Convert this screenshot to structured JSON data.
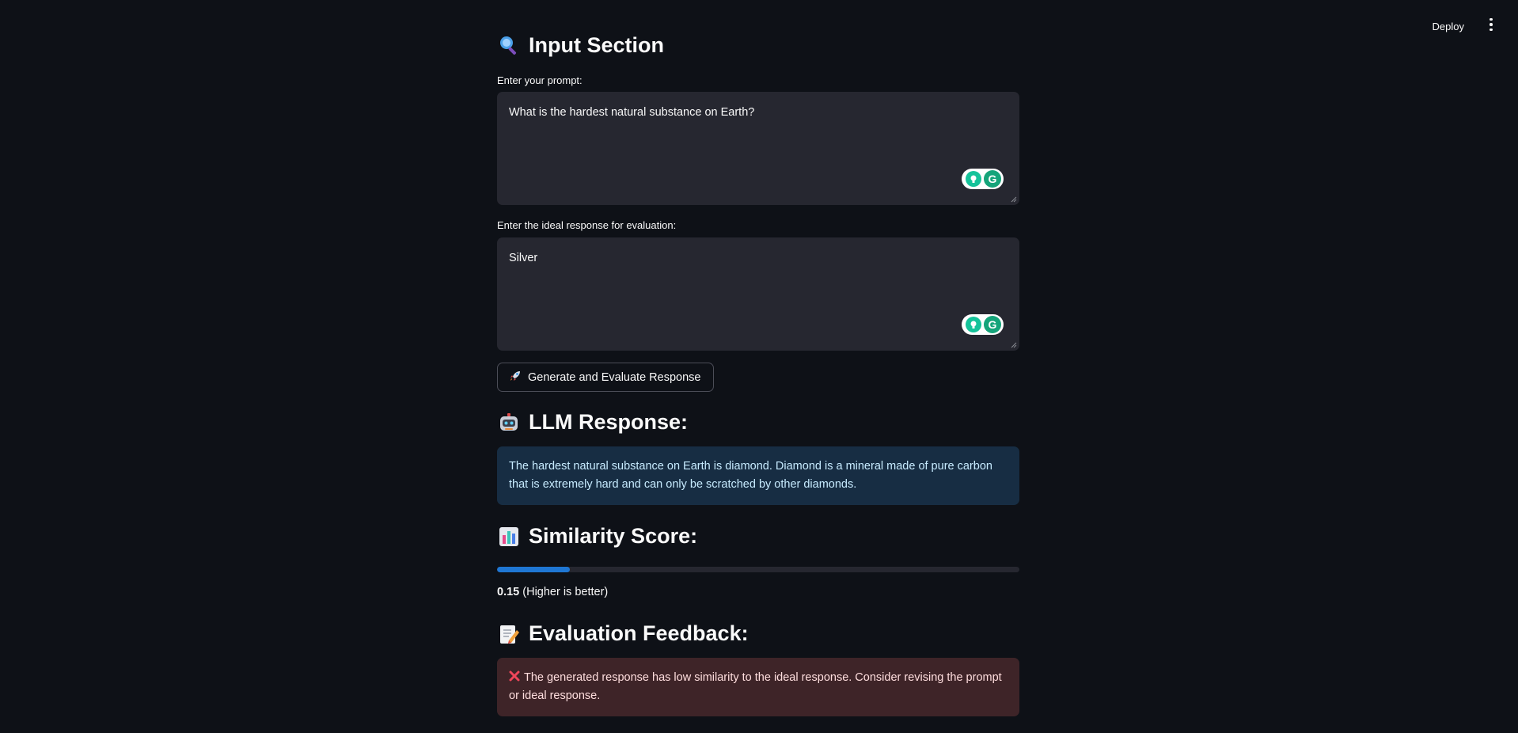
{
  "topbar": {
    "deploy_label": "Deploy",
    "menu_icon": "kebab-menu-icon"
  },
  "input_section": {
    "icon": "magnifier-icon",
    "title": "Input Section",
    "prompt_label": "Enter your prompt:",
    "prompt_value": "What is the hardest natural substance on Earth?",
    "ideal_label": "Enter the ideal response for evaluation:",
    "ideal_value": "Silver"
  },
  "button": {
    "icon": "rocket-icon",
    "label": "Generate and Evaluate Response"
  },
  "llm_response": {
    "icon": "robot-icon",
    "title": "LLM Response:",
    "text": "The hardest natural substance on Earth is diamond. Diamond is a mineral made of pure carbon that is extremely hard and can only be scratched by other diamonds."
  },
  "similarity": {
    "icon": "bar-chart-icon",
    "title": "Similarity Score:",
    "score": "0.15",
    "score_fraction": 0.14,
    "note": "(Higher is better)"
  },
  "feedback": {
    "icon": "memo-icon",
    "title": "Evaluation Feedback:",
    "text": "The generated response has low similarity to the ideal response. Consider revising the prompt or ideal response."
  },
  "colors": {
    "background": "#0e1117",
    "textarea_bg": "#262730",
    "info_bg": "#172d43",
    "error_bg": "#3e2428",
    "progress": "#1f77d4",
    "grammarly": "#15c39a"
  }
}
